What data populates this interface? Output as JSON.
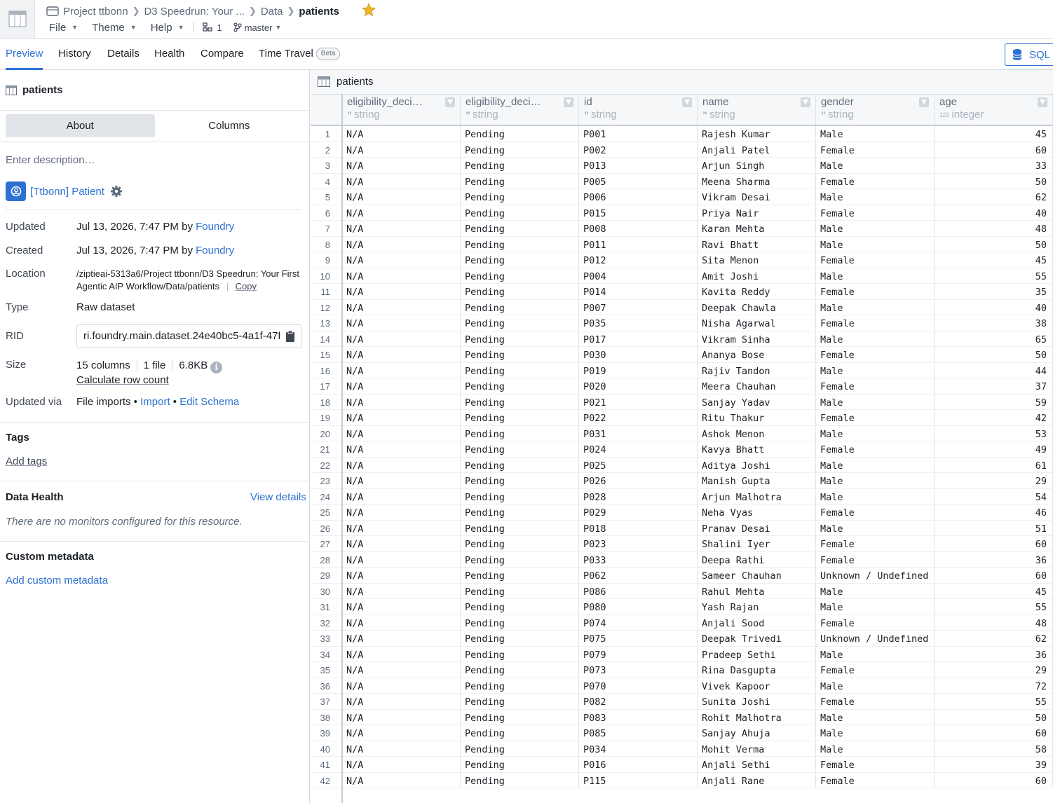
{
  "breadcrumb": {
    "items": [
      "Project ttbonn",
      "D3 Speedrun: Your ...",
      "Data"
    ],
    "current": "patients"
  },
  "menu": {
    "file": "File",
    "theme": "Theme",
    "help": "Help",
    "count": "1",
    "branch": "master"
  },
  "tabs": [
    "Preview",
    "History",
    "Details",
    "Health",
    "Compare",
    "Time Travel"
  ],
  "beta_label": "Beta",
  "sql_button": "SQL c",
  "left": {
    "title": "patients",
    "segments": {
      "about": "About",
      "columns": "Columns"
    },
    "description_placeholder": "Enter description…",
    "ontology_link": "[Ttbonn] Patient",
    "updated": {
      "label": "Updated",
      "date": "Jul 13, 2026, 7:47 PM by ",
      "by": "Foundry"
    },
    "created": {
      "label": "Created",
      "date": "Jul 13, 2026, 7:47 PM by ",
      "by": "Foundry"
    },
    "location": {
      "label": "Location",
      "path": "/ziptieai-5313a6/Project ttbonn/D3 Speedrun: Your First Agentic AIP Workflow/Data/patients",
      "copy": "Copy"
    },
    "type": {
      "label": "Type",
      "value": "Raw dataset"
    },
    "rid": {
      "label": "RID",
      "value": "ri.foundry.main.dataset.24e40bc5-4a1f-47f"
    },
    "size": {
      "label": "Size",
      "columns": "15 columns",
      "files": "1 file",
      "bytes": "6.8KB",
      "row_count": "Calculate row count"
    },
    "updated_via": {
      "label": "Updated via",
      "source": "File imports",
      "import": "Import",
      "edit_schema": "Edit Schema"
    },
    "tags": {
      "title": "Tags",
      "add": "Add tags"
    },
    "data_health": {
      "title": "Data Health",
      "view": "View details",
      "empty": "There are no monitors configured for this resource."
    },
    "custom_metadata": {
      "title": "Custom metadata",
      "add": "Add custom metadata"
    }
  },
  "table": {
    "title": "patients",
    "columns": [
      {
        "name": "eligibility_deci…",
        "type": "string"
      },
      {
        "name": "eligibility_deci…",
        "type": "string"
      },
      {
        "name": "id",
        "type": "string"
      },
      {
        "name": "name",
        "type": "string"
      },
      {
        "name": "gender",
        "type": "string"
      },
      {
        "name": "age",
        "type": "integer"
      }
    ],
    "rows": [
      [
        "N/A",
        "Pending",
        "P001",
        "Rajesh Kumar",
        "Male",
        "45"
      ],
      [
        "N/A",
        "Pending",
        "P002",
        "Anjali Patel",
        "Female",
        "60"
      ],
      [
        "N/A",
        "Pending",
        "P013",
        "Arjun Singh",
        "Male",
        "33"
      ],
      [
        "N/A",
        "Pending",
        "P005",
        "Meena Sharma",
        "Female",
        "50"
      ],
      [
        "N/A",
        "Pending",
        "P006",
        "Vikram Desai",
        "Male",
        "62"
      ],
      [
        "N/A",
        "Pending",
        "P015",
        "Priya Nair",
        "Female",
        "40"
      ],
      [
        "N/A",
        "Pending",
        "P008",
        "Karan Mehta",
        "Male",
        "48"
      ],
      [
        "N/A",
        "Pending",
        "P011",
        "Ravi Bhatt",
        "Male",
        "50"
      ],
      [
        "N/A",
        "Pending",
        "P012",
        "Sita Menon",
        "Female",
        "45"
      ],
      [
        "N/A",
        "Pending",
        "P004",
        "Amit Joshi",
        "Male",
        "55"
      ],
      [
        "N/A",
        "Pending",
        "P014",
        "Kavita Reddy",
        "Female",
        "35"
      ],
      [
        "N/A",
        "Pending",
        "P007",
        "Deepak Chawla",
        "Male",
        "40"
      ],
      [
        "N/A",
        "Pending",
        "P035",
        "Nisha Agarwal",
        "Female",
        "38"
      ],
      [
        "N/A",
        "Pending",
        "P017",
        "Vikram Sinha",
        "Male",
        "65"
      ],
      [
        "N/A",
        "Pending",
        "P030",
        "Ananya Bose",
        "Female",
        "50"
      ],
      [
        "N/A",
        "Pending",
        "P019",
        "Rajiv Tandon",
        "Male",
        "44"
      ],
      [
        "N/A",
        "Pending",
        "P020",
        "Meera Chauhan",
        "Female",
        "37"
      ],
      [
        "N/A",
        "Pending",
        "P021",
        "Sanjay Yadav",
        "Male",
        "59"
      ],
      [
        "N/A",
        "Pending",
        "P022",
        "Ritu Thakur",
        "Female",
        "42"
      ],
      [
        "N/A",
        "Pending",
        "P031",
        "Ashok Menon",
        "Male",
        "53"
      ],
      [
        "N/A",
        "Pending",
        "P024",
        "Kavya Bhatt",
        "Female",
        "49"
      ],
      [
        "N/A",
        "Pending",
        "P025",
        "Aditya Joshi",
        "Male",
        "61"
      ],
      [
        "N/A",
        "Pending",
        "P026",
        "Manish Gupta",
        "Male",
        "29"
      ],
      [
        "N/A",
        "Pending",
        "P028",
        "Arjun Malhotra",
        "Male",
        "54"
      ],
      [
        "N/A",
        "Pending",
        "P029",
        "Neha Vyas",
        "Female",
        "46"
      ],
      [
        "N/A",
        "Pending",
        "P018",
        "Pranav Desai",
        "Male",
        "51"
      ],
      [
        "N/A",
        "Pending",
        "P023",
        "Shalini Iyer",
        "Female",
        "60"
      ],
      [
        "N/A",
        "Pending",
        "P033",
        "Deepa Rathi",
        "Female",
        "36"
      ],
      [
        "N/A",
        "Pending",
        "P062",
        "Sameer Chauhan",
        "Unknown / Undefined",
        "60"
      ],
      [
        "N/A",
        "Pending",
        "P086",
        "Rahul Mehta",
        "Male",
        "45"
      ],
      [
        "N/A",
        "Pending",
        "P080",
        "Yash Rajan",
        "Male",
        "55"
      ],
      [
        "N/A",
        "Pending",
        "P074",
        "Anjali Sood",
        "Female",
        "48"
      ],
      [
        "N/A",
        "Pending",
        "P075",
        "Deepak Trivedi",
        "Unknown / Undefined",
        "62"
      ],
      [
        "N/A",
        "Pending",
        "P079",
        "Pradeep Sethi",
        "Male",
        "36"
      ],
      [
        "N/A",
        "Pending",
        "P073",
        "Rina Dasgupta",
        "Female",
        "29"
      ],
      [
        "N/A",
        "Pending",
        "P070",
        "Vivek Kapoor",
        "Male",
        "72"
      ],
      [
        "N/A",
        "Pending",
        "P082",
        "Sunita Joshi",
        "Female",
        "55"
      ],
      [
        "N/A",
        "Pending",
        "P083",
        "Rohit Malhotra",
        "Male",
        "50"
      ],
      [
        "N/A",
        "Pending",
        "P085",
        "Sanjay Ahuja",
        "Male",
        "60"
      ],
      [
        "N/A",
        "Pending",
        "P034",
        "Mohit Verma",
        "Male",
        "58"
      ],
      [
        "N/A",
        "Pending",
        "P016",
        "Anjali Sethi",
        "Female",
        "39"
      ],
      [
        "N/A",
        "Pending",
        "P115",
        "Anjali Rane",
        "Female",
        "60"
      ]
    ]
  },
  "colors": {
    "accent": "#2d72d2",
    "star": "#f0b726"
  },
  "icons": [
    "dataset-icon",
    "folder-icon",
    "star-icon",
    "branch-icon",
    "graph-icon",
    "gear-icon",
    "clipboard-icon",
    "info-icon",
    "database-icon",
    "object-icon",
    "filter-icon"
  ]
}
